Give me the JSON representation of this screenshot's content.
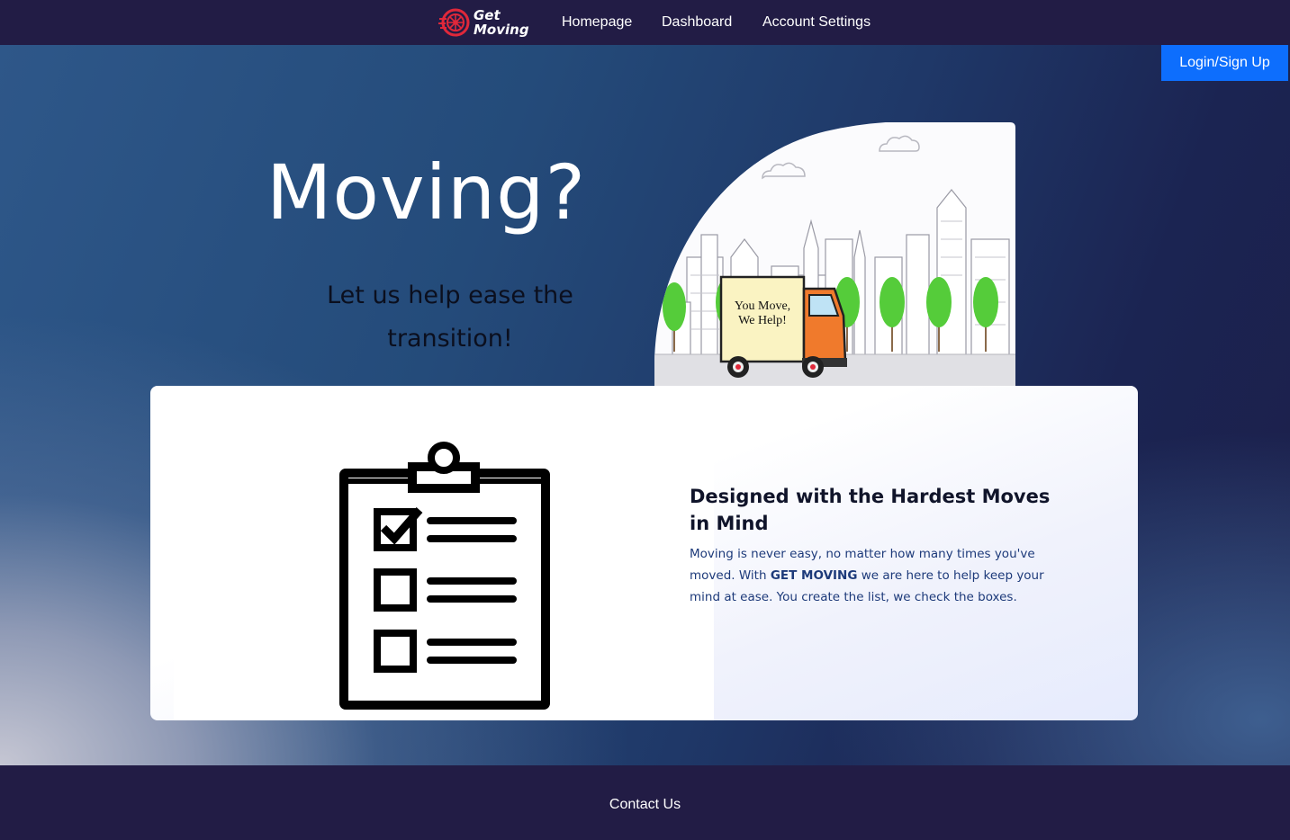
{
  "brand": {
    "line1": "Get",
    "line2": "Moving",
    "accent_color": "#e0283a",
    "logo_icon": "tire-icon"
  },
  "nav": {
    "links": [
      {
        "label": "Homepage"
      },
      {
        "label": "Dashboard"
      },
      {
        "label": "Account Settings"
      }
    ],
    "login_label": "Login/Sign Up",
    "login_color": "#0d6efd",
    "background": "#221c45"
  },
  "hero": {
    "title": "Moving?",
    "subtitle": "Let us help ease the transition!",
    "illustration": {
      "truck_sign_line1": "You Move,",
      "truck_sign_line2": "We Help!",
      "icons": [
        "city-skyline-icon",
        "tree-icon",
        "cloud-icon",
        "moving-truck-icon"
      ]
    }
  },
  "feature": {
    "icon": "checklist-clipboard-icon",
    "heading": "Designed with the Hardest Moves in Mind",
    "text_before": "Moving is never easy, no matter how many times you've moved. With ",
    "text_bold": "GET MOVING",
    "text_after": " we are here to help keep your mind at ease. You create the list, we check the boxes."
  },
  "footer": {
    "contact_label": "Contact Us"
  }
}
